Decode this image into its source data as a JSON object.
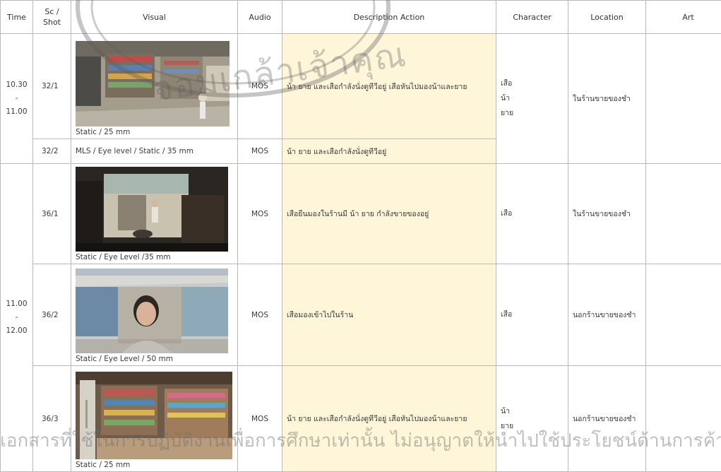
{
  "headers": {
    "time": "Time",
    "shot": "Sc /\nShot",
    "visual": "Visual",
    "audio": "Audio",
    "description": "Description Action",
    "character": "Character",
    "location": "Location",
    "art": "Art"
  },
  "time_blocks": [
    {
      "start": "10.30",
      "sep": "-",
      "end": "11.00"
    },
    {
      "start": "11.00",
      "sep": "-",
      "end": "12.00"
    }
  ],
  "rows": [
    {
      "shot": "32/1",
      "caption": "Static / 25 mm",
      "audio": "MOS",
      "description": "น้า ยาย และเสือกำลังนั่งดูทีวีอยู่ เสือหันไปมองน้าและยาย",
      "characters": [
        "เสือ",
        "น้า",
        "ยาย"
      ],
      "location": "ในร้านขายของชำ",
      "scene_image": "store-interior"
    },
    {
      "shot": "32/2",
      "caption": "MLS / Eye level / Static / 35 mm",
      "audio": "MOS",
      "description": "น้า ยาย และเสือกำลังนั่งดูทีวีอยู่"
    },
    {
      "shot": "36/1",
      "caption": "Static / Eye Level /35 mm",
      "audio": "MOS",
      "description": "เสือยืนมองในร้านมี น้า ยาย กำลังขายของอยู่",
      "characters": [
        "เสือ"
      ],
      "location": "ในร้านขายของชำ",
      "scene_image": "shop-doorway"
    },
    {
      "shot": "36/2",
      "caption": "Static / Eye Level / 50 mm",
      "audio": "MOS",
      "description": "เสือมองเข้าไปในร้าน",
      "characters": [
        "เสือ"
      ],
      "location": "นอกร้านขายของชำ",
      "scene_image": "girl-outside"
    },
    {
      "shot": "36/3",
      "caption": "Static / 25 mm",
      "audio": "MOS",
      "description": "น้า ยาย และเสือกำลังนั่งดูทีวีอยู่ เสือหันไปมองน้าและยาย",
      "characters": [
        "น้า",
        "ยาย"
      ],
      "location": "นอกร้านขายของชำ",
      "scene_image": "store-shelves"
    }
  ],
  "watermark": {
    "seal_text": "จอมเกล้าเจ้าคุณ",
    "footer_text": "เอกสารที่ใช้ในการปฏิบัติงานเพื่อการศึกษาเท่านั้น ไม่อนุญาตให้นำไปใช้ประโยชน์ด้านการค้า"
  },
  "colors": {
    "description_bg": "#fff5d9",
    "grid": "#b9b9b9"
  }
}
